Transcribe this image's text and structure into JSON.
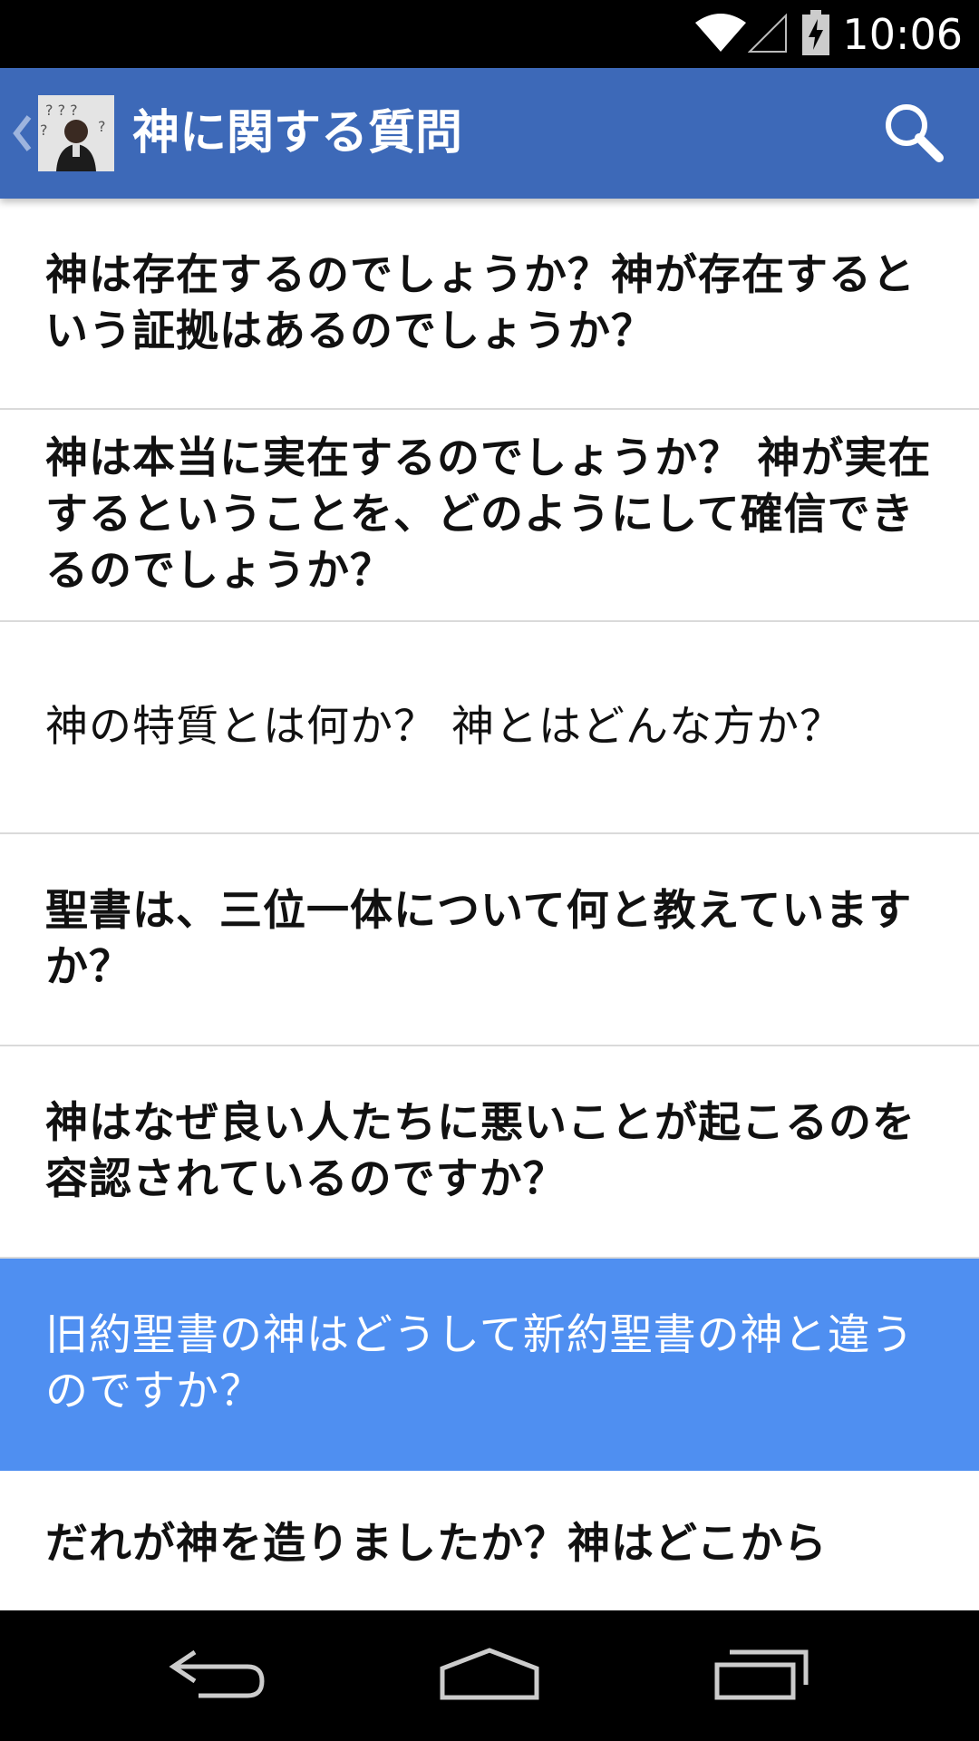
{
  "status_bar": {
    "time": "10:06",
    "icons": [
      "wifi-icon",
      "signal-icon",
      "battery-charging-icon"
    ]
  },
  "action_bar": {
    "title": "神に関する質問",
    "up_icon": "chevron-left-icon",
    "logo": "app-logo",
    "search_icon": "search-icon"
  },
  "questions": [
    {
      "text": "神は存在するのでしょうか？神が存在するという証拠はあるのでしょうか？",
      "bold": true,
      "selected": false
    },
    {
      "text": "神は本当に実在するのでしょうか？ 神が実在するということを、どのようにして確信できるのでしょうか？",
      "bold": true,
      "selected": false
    },
    {
      "text": "神の特質とは何か？ 神とはどんな方か？",
      "bold": false,
      "selected": false
    },
    {
      "text": "聖書は、三位一体について何と教えていますか？",
      "bold": true,
      "selected": false
    },
    {
      "text": "神はなぜ良い人たちに悪いことが起こるのを容認されているのですか？",
      "bold": true,
      "selected": false
    },
    {
      "text": "旧約聖書の神はどうして新約聖書の神と違うのですか？",
      "bold": false,
      "selected": true
    },
    {
      "text": "だれが神を造りましたか？神はどこから",
      "bold": true,
      "selected": false
    }
  ],
  "nav_bar": {
    "icons": [
      "back-icon",
      "home-icon",
      "recents-icon"
    ]
  },
  "colors": {
    "action_bar": "#3d69b8",
    "selected_row": "#4f8ff1",
    "divider": "#dadada",
    "text": "#111111"
  }
}
